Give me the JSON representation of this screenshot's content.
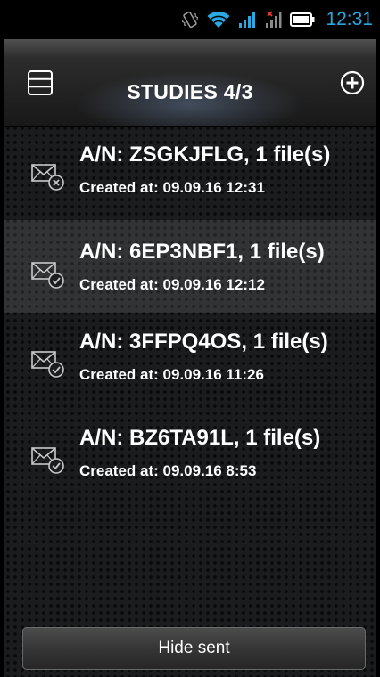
{
  "status_bar": {
    "time": "12:31",
    "icons": [
      "vibrate-icon",
      "wifi-icon",
      "signal-icon",
      "no-signal-icon",
      "battery-icon"
    ],
    "accent_color": "#2aa8e0"
  },
  "header": {
    "title": "STUDIES 4/3",
    "left_icon": "menu-icon",
    "right_icon": "add-circle-icon"
  },
  "studies": [
    {
      "an": "A/N: ZSGKJFLG, 1 file(s)",
      "created": "Created at: 09.09.16 12:31",
      "status_icon": "mail-failed-icon"
    },
    {
      "an": "A/N: 6EP3NBF1, 1 file(s)",
      "created": "Created at: 09.09.16 12:12",
      "status_icon": "mail-sent-icon"
    },
    {
      "an": "A/N: 3FFPQ4OS, 1 file(s)",
      "created": "Created at: 09.09.16 11:26",
      "status_icon": "mail-sent-icon"
    },
    {
      "an": "A/N: BZ6TA91L, 1 file(s)",
      "created": "Created at: 09.09.16 8:53",
      "status_icon": "mail-sent-icon"
    }
  ],
  "footer": {
    "hide_sent_label": "Hide sent"
  }
}
